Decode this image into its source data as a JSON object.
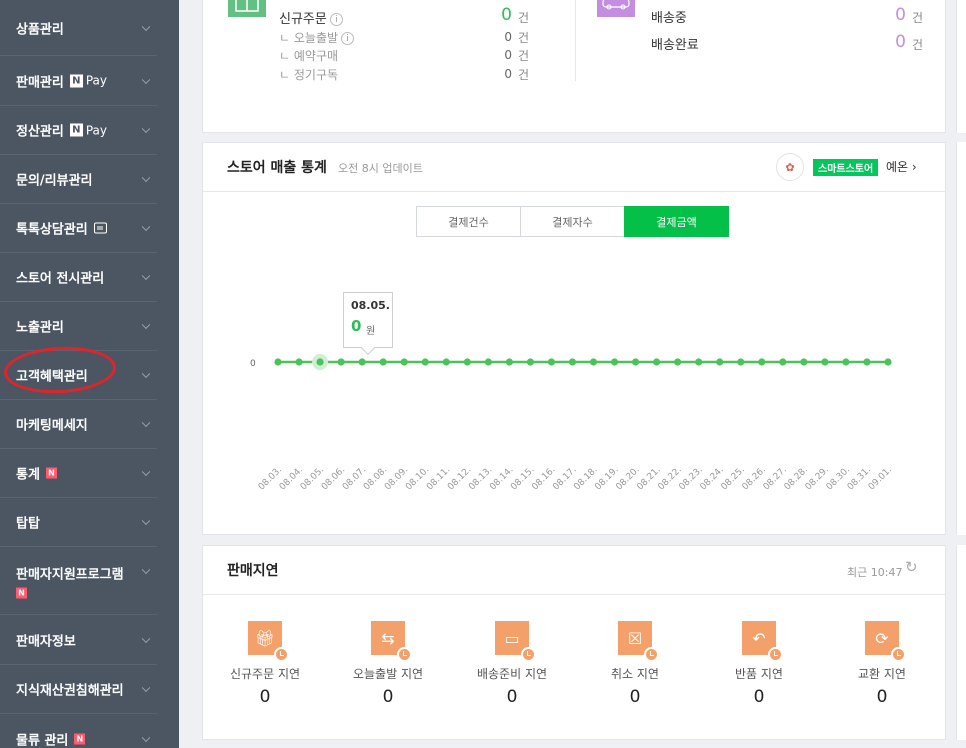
{
  "sidebar": {
    "items": [
      {
        "label": "상품관리"
      },
      {
        "label": "판매관리",
        "pay": "Pay",
        "pay_n": "N"
      },
      {
        "label": "정산관리",
        "pay": "Pay",
        "pay_n": "N"
      },
      {
        "label": "문의/리뷰관리"
      },
      {
        "label": "톡톡상담관리"
      },
      {
        "label": "스토어 전시관리"
      },
      {
        "label": "노출관리"
      },
      {
        "label": "고객혜택관리"
      },
      {
        "label": "마케팅메세지"
      },
      {
        "label": "통계",
        "badge": "N"
      },
      {
        "label": "탑탑"
      },
      {
        "label": "판매자지원프로그램",
        "badge": "N"
      },
      {
        "label": "판매자정보"
      },
      {
        "label": "지식재산권침해관리"
      },
      {
        "label": "물류 관리",
        "badge": "N"
      }
    ]
  },
  "orders": {
    "new_order": {
      "label": "신규주문",
      "count": "0",
      "unit": "건"
    },
    "today_ship": {
      "label": "오늘출발",
      "count": "0",
      "unit": "건"
    },
    "reserve": {
      "label": "예약구매",
      "count": "0",
      "unit": "건"
    },
    "subscription": {
      "label": "정기구독",
      "count": "0",
      "unit": "건"
    },
    "shipping": {
      "label": "배송중",
      "count": "0",
      "unit": "건"
    },
    "delivered": {
      "label": "배송완료",
      "count": "0",
      "unit": "건"
    },
    "info_mark": "i",
    "colors": {
      "green": "#2dbd5a",
      "purple": "#c38ee0"
    }
  },
  "stats": {
    "title": "스토어 매출 통계",
    "updated": "오전 8시 업데이트",
    "smartstore_badge": "스마트스토어",
    "store_name": "예온",
    "more": "›",
    "tabs": [
      "결제건수",
      "결제자수",
      "결제금액"
    ],
    "active_tab": 2,
    "tooltip": {
      "date": "08.05.",
      "value": "0",
      "unit": "원"
    },
    "accent": "#05c048"
  },
  "chart_data": {
    "type": "line",
    "x": [
      "08.03.",
      "08.04.",
      "08.05.",
      "08.06.",
      "08.07.",
      "08.08.",
      "08.09.",
      "08.10.",
      "08.11.",
      "08.12.",
      "08.13.",
      "08.14.",
      "08.15.",
      "08.16.",
      "08.17.",
      "08.18.",
      "08.19.",
      "08.20.",
      "08.21.",
      "08.22.",
      "08.23.",
      "08.24.",
      "08.25.",
      "08.26.",
      "08.27.",
      "08.28.",
      "08.29.",
      "08.30.",
      "08.31.",
      "09.01."
    ],
    "series": [
      {
        "values": [
          0,
          0,
          0,
          0,
          0,
          0,
          0,
          0,
          0,
          0,
          0,
          0,
          0,
          0,
          0,
          0,
          0,
          0,
          0,
          0,
          0,
          0,
          0,
          0,
          0,
          0,
          0,
          0,
          0,
          0
        ]
      }
    ],
    "y_ticks": [
      "0"
    ],
    "highlight_index": 2,
    "color": "#4cc35a"
  },
  "delay": {
    "title": "판매지연",
    "recent": "최근 10:47",
    "refresh": "↻",
    "items": [
      {
        "label": "신규주문 지연",
        "value": "0",
        "icon": "gift-icon"
      },
      {
        "label": "오늘출발 지연",
        "value": "0",
        "icon": "truck-arrow-icon"
      },
      {
        "label": "배송준비 지연",
        "value": "0",
        "icon": "truck-icon"
      },
      {
        "label": "취소 지연",
        "value": "0",
        "icon": "cancel-box-icon"
      },
      {
        "label": "반품 지연",
        "value": "0",
        "icon": "return-icon"
      },
      {
        "label": "교환 지연",
        "value": "0",
        "icon": "exchange-icon"
      }
    ],
    "icon_color": "#f4a06a"
  }
}
